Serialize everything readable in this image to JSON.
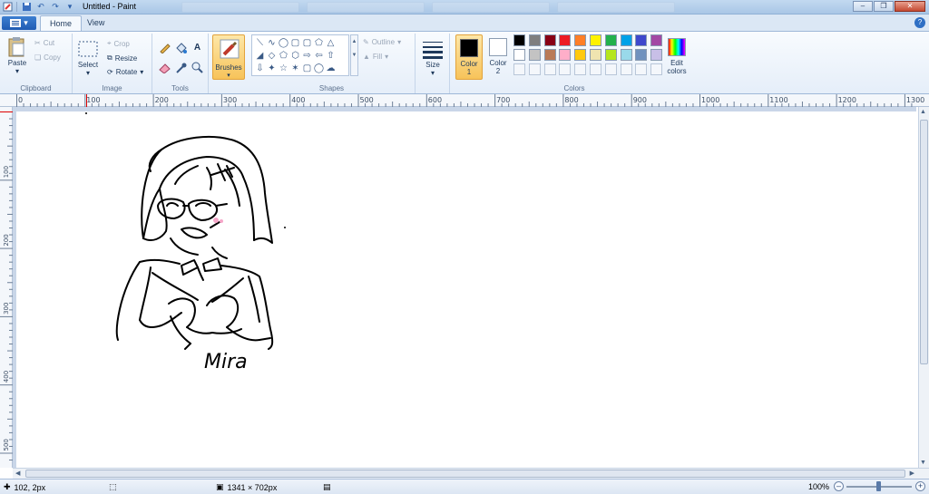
{
  "window": {
    "title": "Untitled - Paint"
  },
  "tabs": {
    "file_label": "",
    "home": "Home",
    "view": "View"
  },
  "clipboard": {
    "group": "Clipboard",
    "paste": "Paste",
    "cut": "Cut",
    "copy": "Copy"
  },
  "image": {
    "group": "Image",
    "select": "Select",
    "crop": "Crop",
    "resize": "Resize",
    "rotate": "Rotate"
  },
  "tools": {
    "group": "Tools",
    "brushes": "Brushes"
  },
  "shapes": {
    "group": "Shapes",
    "outline": "Outline",
    "fill": "Fill"
  },
  "size": {
    "label": "Size"
  },
  "colors": {
    "group": "Colors",
    "color1": "Color\n1",
    "color1_line1": "Color",
    "color1_line2": "1",
    "color2_line1": "Color",
    "color2_line2": "2",
    "edit_line1": "Edit",
    "edit_line2": "colors",
    "color1_value": "#000000",
    "color2_value": "#ffffff",
    "palette_row1": [
      "#000000",
      "#7f7f7f",
      "#880015",
      "#ed1c24",
      "#ff7f27",
      "#fff200",
      "#22b14c",
      "#00a2e8",
      "#3f48cc",
      "#a349a4"
    ],
    "palette_row2": [
      "#ffffff",
      "#c3c3c3",
      "#b97a57",
      "#ffaec9",
      "#ffc90e",
      "#efe4b0",
      "#b5e61d",
      "#99d9ea",
      "#7092be",
      "#c8bfe7"
    ]
  },
  "ruler": {
    "top": [
      "0",
      "100",
      "200",
      "300",
      "400",
      "500",
      "600",
      "700",
      "800",
      "900",
      "1000",
      "1100",
      "1200",
      "1300"
    ],
    "left": [
      "100",
      "200",
      "300",
      "400",
      "500"
    ]
  },
  "drawing": {
    "signature": "Mira"
  },
  "status": {
    "cursor": "102, 2px",
    "size": "1341 × 702px",
    "zoom": "100%"
  }
}
